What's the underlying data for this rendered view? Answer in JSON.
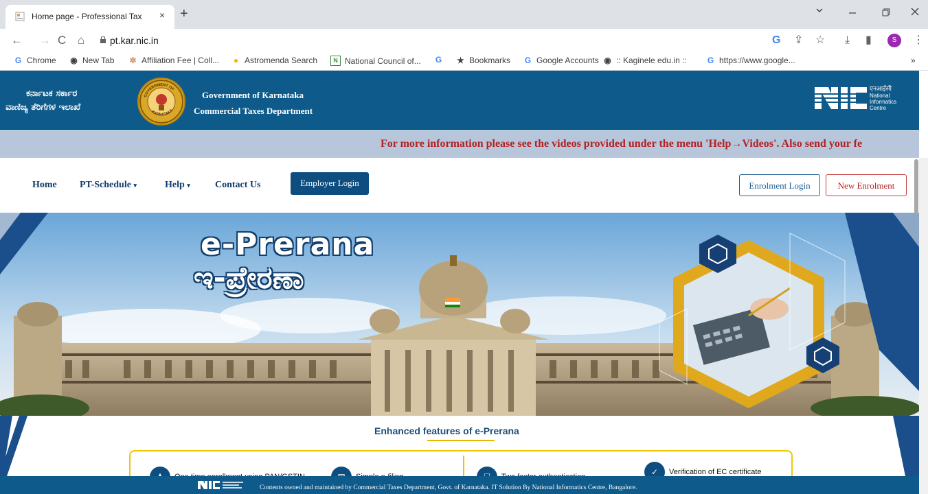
{
  "browser": {
    "tab_title": "Home page - Professional Tax",
    "tab_close": "×",
    "new_tab": "+",
    "url": "pt.kar.nic.in",
    "profile_initial": "S",
    "bookmarks": [
      {
        "label": "Chrome",
        "icon": "google-icon"
      },
      {
        "label": "New Tab",
        "icon": "globe-icon"
      },
      {
        "label": "Affiliation Fee | Coll...",
        "icon": "site-icon"
      },
      {
        "label": "Astromenda Search",
        "icon": "astromenda-icon"
      },
      {
        "label": "National Council of...",
        "icon": "ncert-icon"
      },
      {
        "label": "",
        "icon": "google-icon"
      },
      {
        "label": "Bookmarks",
        "icon": "star-icon"
      },
      {
        "label": "Google Accounts",
        "icon": "google-icon"
      },
      {
        "label": ":: Kaginele edu.in ::",
        "icon": "globe-icon"
      },
      {
        "label": "https://www.google...",
        "icon": "google-icon"
      }
    ],
    "bookmarks_more": "»"
  },
  "header": {
    "kannada_line1": "ಕರ್ನಾಟಕ ಸರ್ಕಾರ",
    "kannada_line2": "ವಾಣಿಜ್ಯ ತೆರಿಗೆಗಳ ಇಲಾಖೆ",
    "english_line1": "Government of Karnataka",
    "english_line2": "Commercial Taxes Department",
    "emblem_text_top": "GOVERNMENT OF",
    "emblem_text_bottom": "KARNATAKA",
    "nic_hindi": "एनआईसी",
    "nic_line1": "National",
    "nic_line2": "Informatics",
    "nic_line3": "Centre"
  },
  "marquee": {
    "text": "For more information please see the videos provided under the menu 'Help→Videos'. Also send your fe"
  },
  "nav": {
    "home": "Home",
    "pt_schedule": "PT-Schedule",
    "help": "Help",
    "contact": "Contact Us",
    "employer_login": "Employer Login",
    "enrolment_login": "Enrolment Login",
    "new_enrolment": "New Enrolment"
  },
  "banner": {
    "title_en": "e-Prerana",
    "title_kn": "ಇ-ಪ್ರೇರಣಾ"
  },
  "features": {
    "title": "Enhanced features of e-Prerana",
    "items": [
      "One time enrollment using PAN/GSTIN",
      "Simple e-filing",
      "Two factor authentication",
      "Verification of EC certificate"
    ]
  },
  "footer": {
    "text": "Contents owned and maintained by Commercial Taxes Department, Govt. of Karnataka. IT Solution By National Informatics Centre, Bangalore."
  },
  "colors": {
    "header_blue": "#0e5a8a",
    "marquee_bg": "#b8c6dc",
    "marquee_text": "#b22222",
    "nav_text": "#123f6e",
    "accent_gold": "#f2c500"
  }
}
